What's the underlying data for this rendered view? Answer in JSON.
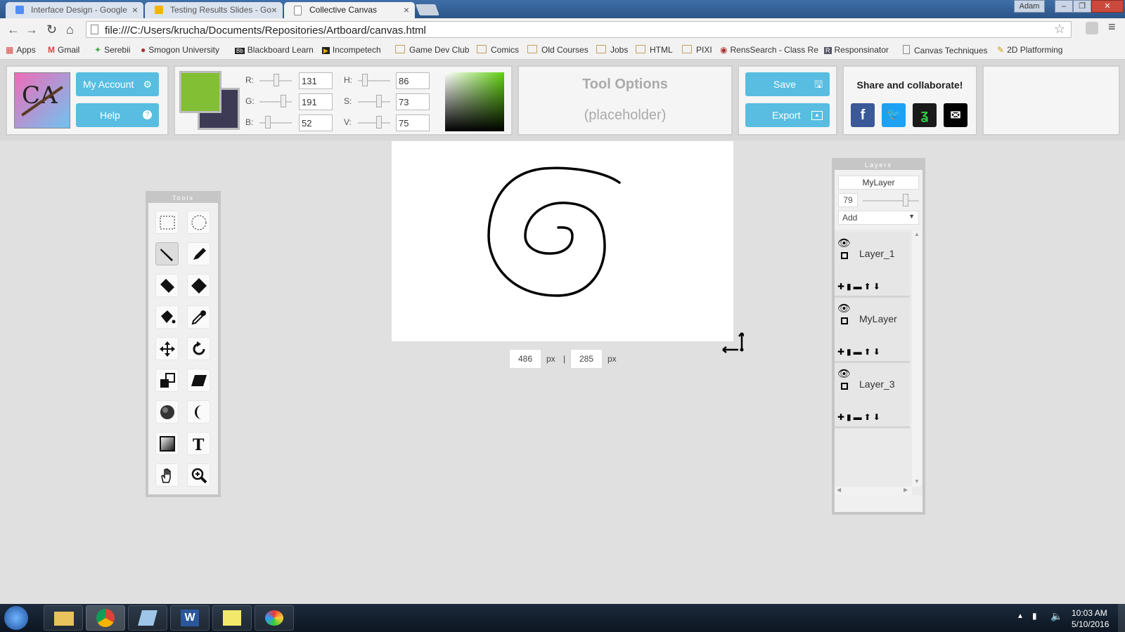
{
  "browser": {
    "tabs": [
      {
        "title": "Interface Design - Google"
      },
      {
        "title": "Testing Results Slides - Go"
      },
      {
        "title": "Collective Canvas"
      }
    ],
    "user": "Adam",
    "url": "file:///C:/Users/krucha/Documents/Repositories/Artboard/canvas.html",
    "bookmarks": [
      "Apps",
      "Gmail",
      "Serebii",
      "Smogon University",
      "Blackboard Learn",
      "Incompetech",
      "Game Dev Club",
      "Comics",
      "Old Courses",
      "Jobs",
      "HTML",
      "PIXI",
      "RensSearch - Class Re",
      "Responsinator",
      "Canvas Techniques",
      "2D Platforming"
    ]
  },
  "header": {
    "logo_text": "CA",
    "my_account": "My Account",
    "help": "Help",
    "color": {
      "primary": "#83bf34",
      "secondary": "#3c3a55",
      "r_label": "R:",
      "g_label": "G:",
      "b_label": "B:",
      "h_label": "H:",
      "s_label": "S:",
      "v_label": "V:",
      "r": "131",
      "g": "191",
      "b": "52",
      "h": "86",
      "s": "73",
      "v": "75"
    },
    "tool_options_title": "Tool Options",
    "tool_options_sub": "(placeholder)",
    "save": "Save",
    "export": "Export",
    "share_title": "Share and collaborate!"
  },
  "tools": {
    "title": "Tools"
  },
  "canvas": {
    "width": "486",
    "height": "285",
    "unit": "px",
    "separator": "|"
  },
  "layers": {
    "title": "Layers",
    "name_field": "MyLayer",
    "opacity": "79",
    "blend": "Add",
    "items": [
      {
        "name": "Layer_1"
      },
      {
        "name": "MyLayer"
      },
      {
        "name": "Layer_3"
      }
    ]
  },
  "taskbar": {
    "time": "10:03 AM",
    "date": "5/10/2016"
  }
}
